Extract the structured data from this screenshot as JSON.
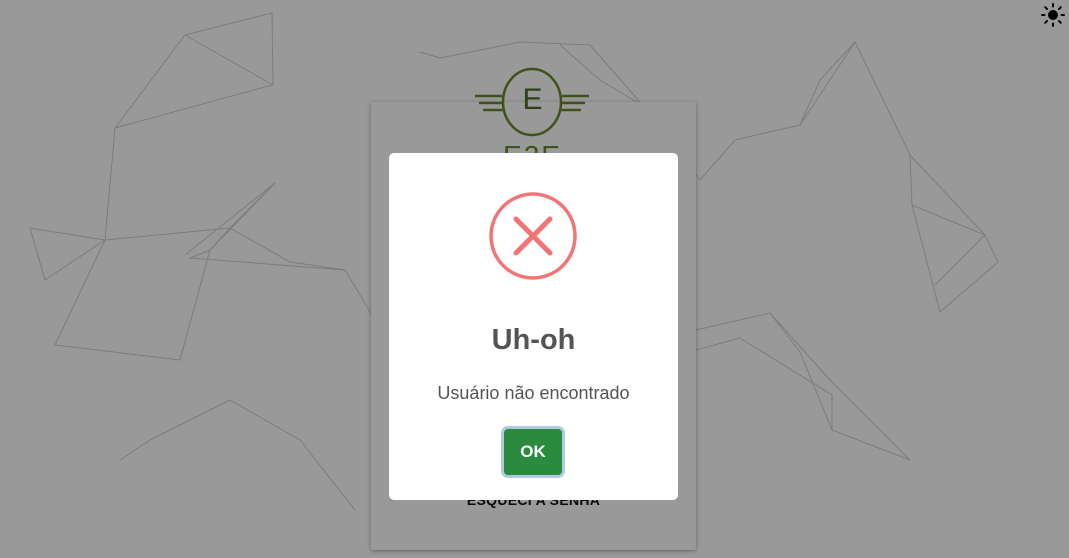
{
  "theme": {
    "toggle_icon": "sun-icon",
    "overlay_color": "rgba(0,0,0,0.4)"
  },
  "login": {
    "logo_letter": "E",
    "logo_name": "E2E",
    "forgot_password": "ESQUECI A SENHA",
    "brand_color": "#6a8a2a"
  },
  "alert": {
    "icon": "error-x-icon",
    "icon_color": "#f27474",
    "title": "Uh-oh",
    "message": "Usuário não encontrado",
    "ok_label": "OK",
    "ok_color": "#2a8a3e"
  }
}
